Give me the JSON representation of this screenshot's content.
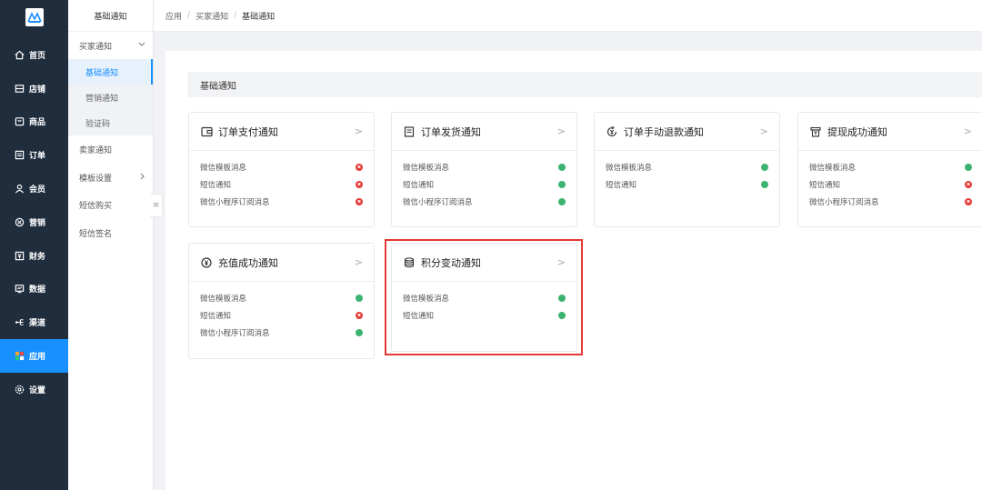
{
  "nav": {
    "items": [
      {
        "label": "首页",
        "icon": "home-icon"
      },
      {
        "label": "店铺",
        "icon": "store-icon"
      },
      {
        "label": "商品",
        "icon": "goods-icon"
      },
      {
        "label": "订单",
        "icon": "order-icon"
      },
      {
        "label": "会员",
        "icon": "member-icon"
      },
      {
        "label": "营销",
        "icon": "marketing-icon"
      },
      {
        "label": "财务",
        "icon": "finance-icon"
      },
      {
        "label": "数据",
        "icon": "data-icon"
      },
      {
        "label": "渠道",
        "icon": "channel-icon"
      },
      {
        "label": "应用",
        "icon": "apps-icon"
      },
      {
        "label": "设置",
        "icon": "settings-icon"
      }
    ],
    "active_index": 9,
    "accent": "#1890ff"
  },
  "sub": {
    "title": "基础通知",
    "group_buyer": "买家通知",
    "children": [
      "基础通知",
      "营销通知",
      "验证码"
    ],
    "seller": "卖家通知",
    "template": "模板设置",
    "sms_buy": "短信购买",
    "sms_sign": "短信签名"
  },
  "breadcrumb": [
    "应用",
    "买家通知",
    "基础通知"
  ],
  "section": {
    "title": "基础通知"
  },
  "cards": [
    {
      "title": "订单支付通知",
      "icon": "wallet-icon",
      "rows": [
        {
          "label": "微信模板消息",
          "on": false
        },
        {
          "label": "短信通知",
          "on": false
        },
        {
          "label": "微信小程序订阅消息",
          "on": false
        }
      ]
    },
    {
      "title": "订单发货通知",
      "icon": "document-icon",
      "rows": [
        {
          "label": "微信模板消息",
          "on": true
        },
        {
          "label": "短信通知",
          "on": true
        },
        {
          "label": "微信小程序订阅消息",
          "on": true
        }
      ]
    },
    {
      "title": "订单手动退款通知",
      "icon": "refund-icon",
      "rows": [
        {
          "label": "微信模板消息",
          "on": true
        },
        {
          "label": "短信通知",
          "on": true
        }
      ]
    },
    {
      "title": "提现成功通知",
      "icon": "withdraw-icon",
      "rows": [
        {
          "label": "微信模板消息",
          "on": true
        },
        {
          "label": "短信通知",
          "on": false
        },
        {
          "label": "微信小程序订阅消息",
          "on": false
        }
      ]
    },
    {
      "title": "充值成功通知",
      "icon": "yuan-circle-icon",
      "rows": [
        {
          "label": "微信模板消息",
          "on": true
        },
        {
          "label": "短信通知",
          "on": false
        },
        {
          "label": "微信小程序订阅消息",
          "on": true
        }
      ]
    },
    {
      "title": "积分变动通知",
      "icon": "database-icon",
      "rows": [
        {
          "label": "微信模板消息",
          "on": true
        },
        {
          "label": "短信通知",
          "on": true
        }
      ]
    }
  ],
  "status_colors": {
    "on": "#3cb371",
    "off": "#e53935"
  },
  "highlight_color": "#e53935"
}
